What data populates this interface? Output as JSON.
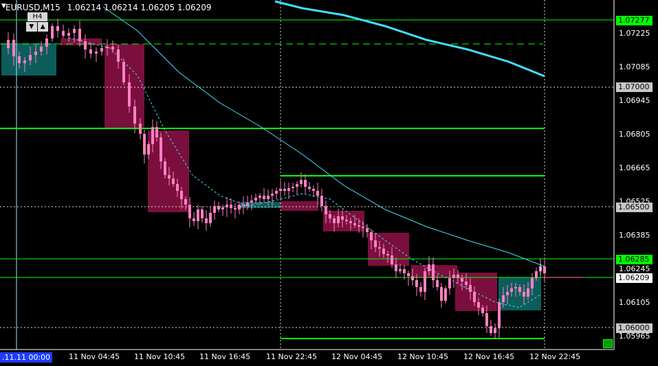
{
  "header": {
    "menu_icon": "triangle-down-icon",
    "symbol": "EURUSD,M15",
    "ohlc": "1.06214 1.06214 1.06205 1.06209",
    "timeframe_button": "H4",
    "scroll_up_icon": "triangle-down-icon",
    "scroll_down_icon": "triangle-up-icon"
  },
  "price_axis": {
    "labels": [
      "1.07225",
      "1.07085",
      "1.06945",
      "1.06805",
      "1.06665",
      "1.06525",
      "1.06385",
      "1.06245",
      "1.06105",
      "1.05965"
    ],
    "tags": [
      {
        "text": "1.07277",
        "style": "green"
      },
      {
        "text": "1.07000",
        "style": "gray"
      },
      {
        "text": "1.06500",
        "style": "gray"
      },
      {
        "text": "1.06285",
        "style": "green"
      },
      {
        "text": "1.06209",
        "style": "white"
      },
      {
        "text": "1.06000",
        "style": "gray"
      }
    ]
  },
  "time_axis": {
    "labels": [
      ".11.11 00:00",
      "11 Nov 04:45",
      "11 Nov 10:45",
      "11 Nov 16:45",
      "11 Nov 22:45",
      "12 Nov 04:45",
      "12 Nov 10:45",
      "12 Nov 16:45",
      "12 Nov 22:45"
    ]
  },
  "colors": {
    "background": "#000000",
    "bull_candle": "#ff80c0",
    "bear_candle": "#ff80c0",
    "bear_box": "#7a0f3d",
    "bull_box": "#0d5c5c",
    "ma_slow": "#40e0ff",
    "ma_mid": "#40e0ff",
    "level_line": "#00ff00",
    "grid_dotted": "#ffffff"
  },
  "chart_data": {
    "type": "candlestick",
    "price_range": [
      1.0592,
      1.0735
    ],
    "levels": [
      1.07277,
      1.07175,
      1.0682,
      1.0661,
      1.06285,
      1.06209,
      1.0598
    ],
    "round_levels": [
      1.07,
      1.065,
      1.06
    ],
    "last_price": 1.06209
  },
  "corner_button": "-"
}
